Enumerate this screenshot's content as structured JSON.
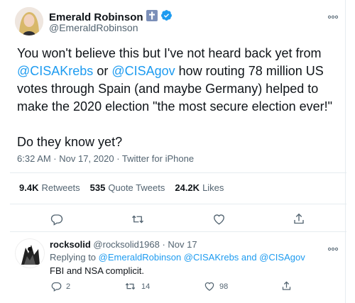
{
  "tweet": {
    "author_name": "Emerald Robinson",
    "author_handle": "@EmeraldRobinson",
    "text_part1": "You won't believe this but I've not heard back yet from",
    "mention1": "@CISAKrebs",
    "text_or": " or ",
    "mention2": "@CISAgov",
    "text_part2": " how routing 78 million US votes through Spain (and maybe Germany) helped to make the 2020 election \"the most secure election ever!\"",
    "text_part3": "Do they know yet?",
    "timestamp": "6:32 AM · Nov 17, 2020 · ",
    "source": "Twitter for iPhone"
  },
  "stats": {
    "retweets_count": "9.4K",
    "retweets_label": "Retweets",
    "quotes_count": "535",
    "quotes_label": "Quote Tweets",
    "likes_count": "24.2K",
    "likes_label": "Likes"
  },
  "reply": {
    "author_name": "rocksolid",
    "author_handle": "@rocksolid1968",
    "date": " · Nov 17",
    "replying_prefix": "Replying to ",
    "replying_to": "@EmeraldRobinson @CISAKrebs and @CISAgov",
    "text": "FBI and NSA complicit.",
    "reply_count": "2",
    "retweet_count": "14",
    "like_count": "98"
  },
  "colors": {
    "link": "#1d9bf0",
    "secondary_text": "#536471",
    "verified_badge": "#1d9bf0",
    "cross_badge": "#7b8fb8"
  },
  "icons": [
    "more-icon",
    "cross-emoji-icon",
    "verified-badge-icon",
    "reply-icon",
    "retweet-icon",
    "like-icon",
    "share-icon"
  ]
}
